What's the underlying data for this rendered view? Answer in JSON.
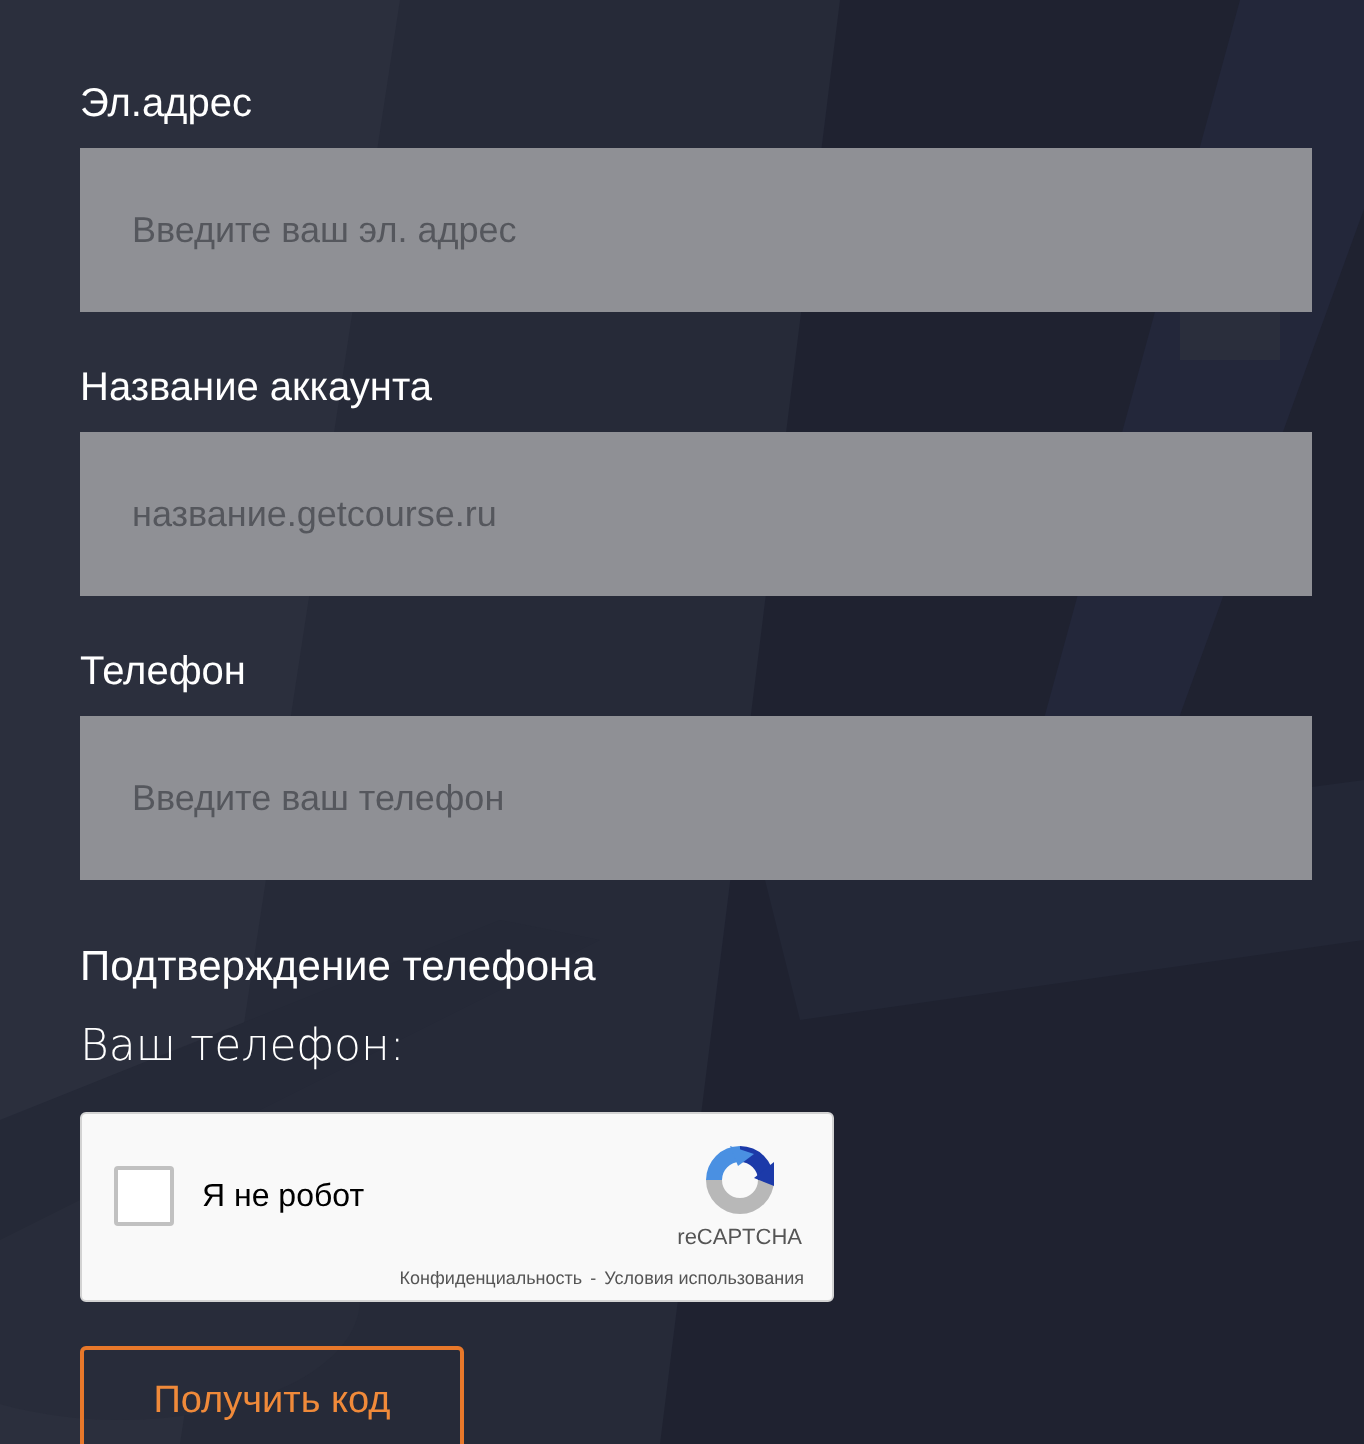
{
  "fields": [
    {
      "label": "Эл.адрес",
      "placeholder": "Введите ваш эл. адрес"
    },
    {
      "label": "Название аккаунта",
      "placeholder": "название.getcourse.ru"
    },
    {
      "label": "Телефон",
      "placeholder": "Введите ваш телефон"
    }
  ],
  "phone_confirmation": {
    "title": "Подтверждение телефона",
    "prompt": "Ваш телефон:"
  },
  "captcha": {
    "checked": false,
    "label": "Я не робот",
    "brand": "reCAPTCHA",
    "privacy_link": "Конфиденциальность",
    "separator": "-",
    "terms_link": "Условия использования"
  },
  "submit_button": {
    "label": "Получить код"
  }
}
